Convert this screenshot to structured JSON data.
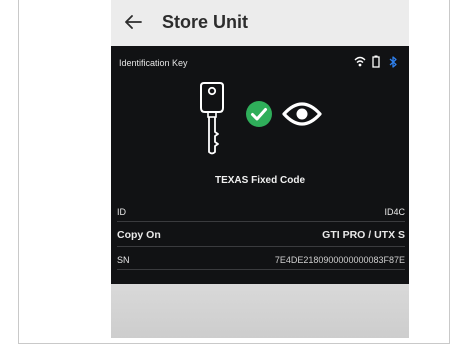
{
  "header": {
    "title": "Store Unit"
  },
  "screen": {
    "status_label": "Identification Key",
    "status_icons": [
      "wifi-icon",
      "battery-icon",
      "bluetooth-icon"
    ],
    "transponder_type": "TEXAS Fixed Code",
    "details": [
      {
        "label": "ID",
        "value": "ID4C"
      },
      {
        "label": "Copy On",
        "value": "GTI PRO / UTX S"
      },
      {
        "label": "SN",
        "value": "7E4DE2180900000000083F87E"
      }
    ]
  },
  "colors": {
    "screen_bg": "#111214",
    "success": "#2fae5a",
    "bluetooth": "#2f80ed"
  }
}
